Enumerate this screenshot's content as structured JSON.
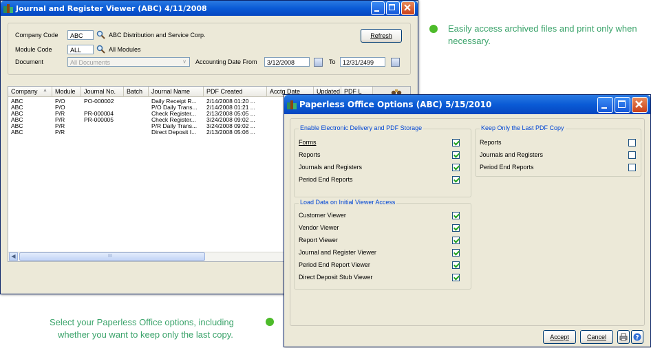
{
  "jr": {
    "title": "Journal and Register Viewer (ABC) 4/11/2008",
    "company_code_label": "Company Code",
    "company_code": "ABC",
    "company_name": "ABC Distribution and Service Corp.",
    "module_code_label": "Module Code",
    "module_code": "ALL",
    "module_name": "All Modules",
    "document_label": "Document",
    "document_value": "All Documents",
    "date_from_label": "Accounting Date From",
    "date_from": "3/12/2008",
    "date_to_label": "To",
    "date_to": "12/31/2499",
    "refresh_label": "Refresh",
    "columns": [
      "Company",
      "Module",
      "Journal No.",
      "Batch",
      "Journal Name",
      "PDF Created",
      "Acctg Date",
      "Updated",
      "PDF L"
    ],
    "rows": [
      [
        "ABC",
        "P/O",
        "PO-000002",
        "",
        "Daily Receipt R...",
        "2/14/2008 01:20 ..."
      ],
      [
        "ABC",
        "P/O",
        "",
        "",
        "P/O Daily Trans...",
        "2/14/2008 01:21 ..."
      ],
      [
        "ABC",
        "P/R",
        "PR-000004",
        "",
        "Check Register...",
        "2/13/2008 05:05 ..."
      ],
      [
        "ABC",
        "P/R",
        "PR-000005",
        "",
        "Check Register...",
        "3/24/2008 09:02 ..."
      ],
      [
        "ABC",
        "P/R",
        "",
        "",
        "P/R Daily Trans...",
        "3/24/2008 09:02 ..."
      ],
      [
        "ABC",
        "P/R",
        "",
        "",
        "Direct Deposit I...",
        "2/13/2008 05:06 ..."
      ]
    ],
    "scroll_grip": "III"
  },
  "po": {
    "title": "Paperless Office Options (ABC) 5/15/2010",
    "group1_title": "Enable Electronic Delivery and PDF Storage",
    "group1": [
      {
        "label": "Forms",
        "checked": true
      },
      {
        "label": "Reports",
        "checked": true
      },
      {
        "label": "Journals and Registers",
        "checked": true
      },
      {
        "label": "Period End Reports",
        "checked": true
      }
    ],
    "group2_title": "Load Data on Initial Viewer Access",
    "group2": [
      {
        "label": "Customer Viewer",
        "checked": true
      },
      {
        "label": "Vendor Viewer",
        "checked": true
      },
      {
        "label": "Report Viewer",
        "checked": true
      },
      {
        "label": "Journal and Register Viewer",
        "checked": true
      },
      {
        "label": "Period End Report Viewer",
        "checked": true
      },
      {
        "label": "Direct Deposit Stub Viewer",
        "checked": true
      }
    ],
    "group3_title": "Keep Only the Last PDF Copy",
    "group3": [
      {
        "label": "Reports",
        "checked": false
      },
      {
        "label": "Journals and Registers",
        "checked": false
      },
      {
        "label": "Period End Reports",
        "checked": false
      }
    ],
    "accept_label": "Accept",
    "cancel_label": "Cancel"
  },
  "notes": {
    "top": "Easily access archived files and print only when necessary.",
    "bottom_line1": "Select your Paperless Office options, including",
    "bottom_line2": "whether you want to keep only the last copy."
  },
  "colors": {
    "accent_green": "#3aa36a",
    "bullet": "#4dbb2a",
    "title_blue": "#0a5bd6"
  }
}
